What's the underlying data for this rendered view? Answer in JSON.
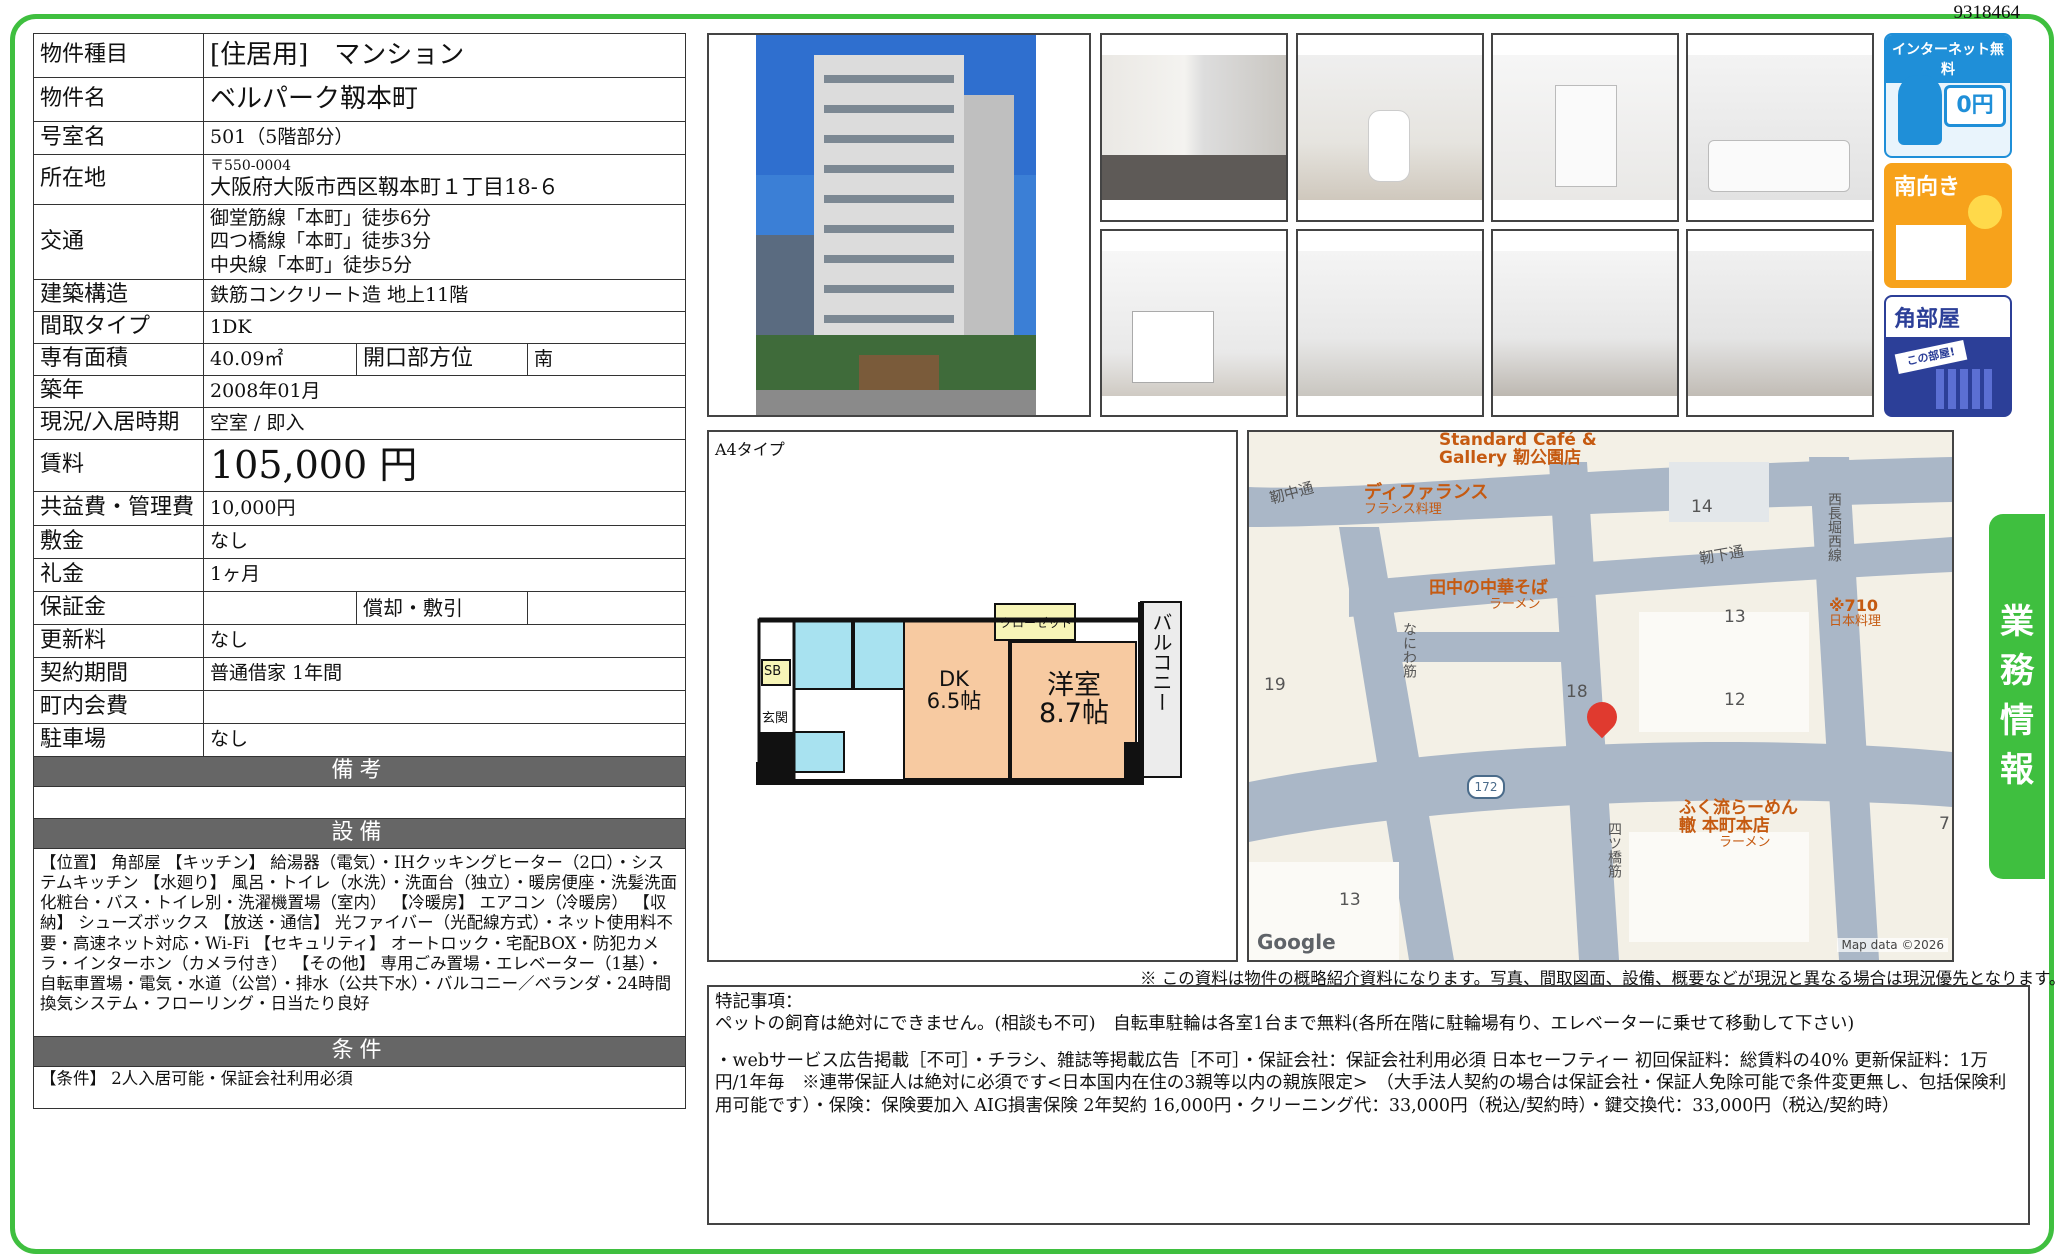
{
  "doc_id": "9318464",
  "side_tab": [
    "業",
    "務",
    "情",
    "報"
  ],
  "property": {
    "type_label": "物件種目",
    "type_value": "[住居用]　マンション",
    "name_label": "物件名",
    "name_value": "ベルパーク靱本町",
    "room_label": "号室名",
    "room_value": "501（5階部分）",
    "address_label": "所在地",
    "postal": "〒550-0004",
    "address": "大阪府大阪市西区靱本町１丁目18-６",
    "traffic_label": "交通",
    "traffic": [
      "御堂筋線「本町」徒歩6分",
      "四つ橋線「本町」徒歩3分",
      "中央線「本町」徒歩5分"
    ],
    "structure_label": "建築構造",
    "structure_value": "鉄筋コンクリート造 地上11階",
    "layout_label": "間取タイプ",
    "layout_value": "1DK",
    "area_label": "専有面積",
    "area_value": "40.09㎡",
    "opening_label": "開口部方位",
    "opening_value": "南",
    "built_label": "築年",
    "built_value": "2008年01月",
    "status_label": "現況/入居時期",
    "status_value": "空室 / 即入",
    "rent_label": "賃料",
    "rent_value": "105,000 円",
    "fee_label": "共益費・管理費",
    "fee_value": "10,000円",
    "deposit_label": "敷金",
    "deposit_value": "なし",
    "key_money_label": "礼金",
    "key_money_value": "1ヶ月",
    "guarantee_label": "保証金",
    "guarantee_value": "",
    "amort_label": "償却・敷引",
    "amort_value": "",
    "renewal_label": "更新料",
    "renewal_value": "なし",
    "contract_label": "契約期間",
    "contract_value": "普通借家 1年間",
    "town_fee_label": "町内会費",
    "town_fee_value": "",
    "parking_label": "駐車場",
    "parking_value": "なし"
  },
  "remarks": {
    "header": "備考",
    "text": ""
  },
  "equipment": {
    "header": "設備",
    "text": "【位置】 角部屋 【キッチン】 給湯器（電気）・IHクッキングヒーター（2口）・システムキッチン 【水廻り】 風呂・トイレ（水洗）・洗面台（独立）・暖房便座・洗髪洗面化粧台・バス・トイレ別・洗濯機置場（室内） 【冷暖房】 エアコン（冷暖房） 【収納】 シューズボックス 【放送・通信】 光ファイバー（光配線方式）・ネット使用料不要・高速ネット対応・Wi-Fi 【セキュリティ】 オートロック・宅配BOX・防犯カメラ・インターホン（カメラ付き） 【その他】 専用ごみ置場・エレベーター（1基）・自転車置場・電気・水道（公営）・排水（公共下水）・バルコニー／ベランダ・24時間換気システム・フローリング・日当たり良好"
  },
  "conditions": {
    "header": "条件",
    "text": "【条件】 2人入居可能・保証会社利用必須"
  },
  "badges": {
    "internet": "インターネット無料",
    "internet_price": "0円",
    "south": "南向き",
    "corner": "角部屋",
    "corner_sub": "この部屋!"
  },
  "floorplan": {
    "type_label": "A4タイプ",
    "closet": "クローゼット",
    "dk_name": "DK",
    "dk_size": "6.5帖",
    "western_name": "洋室",
    "western_size": "8.7帖",
    "balcony": "バルコニー",
    "sb": "SB",
    "entrance": "玄関"
  },
  "map": {
    "labels": [
      "Standard Café &",
      "Gallery 靭公園店",
      "ディファランス",
      "フランス料理",
      "田中の中華そば",
      "ラーメン",
      "ふく流らーめん",
      "轍 本町本店",
      "ラーメン",
      "※710",
      "日本料理",
      "靭中通",
      "靭下通",
      "西長堀西線",
      "なにわ筋",
      "四ツ橋筋",
      "14",
      "13",
      "12",
      "18",
      "19",
      "13",
      "7",
      "172"
    ],
    "brand": "Google",
    "credit": "Map data ©2026"
  },
  "disclaimer": "※ この資料は物件の概略紹介資料になります。写真、間取図面、設備、概要などが現況と異なる場合は現況優先となります。",
  "special": {
    "title": "特記事項：",
    "line1": "ペットの飼育は絶対にできません。(相談も不可)　自転車駐輪は各室1台まで無料(各所在階に駐輪場有り、エレベーターに乗せて移動して下さい)",
    "line2": "・webサービス広告掲載［不可］・チラシ、雑誌等掲載広告［不可］・保証会社：保証会社利用必須 日本セーフティー 初回保証料：総賃料の40% 更新保証料：1万円/1年毎　※連帯保証人は絶対に必須です<日本国内在住の3親等以内の親族限定>　（大手法人契約の場合は保証会社・保証人免除可能で条件変更無し、包括保険利用可能です）・保険：保険要加入 AIG損害保険 2年契約 16,000円・クリーニング代：33,000円（税込/契約時）・鍵交換代：33,000円（税込/契約時）"
  }
}
